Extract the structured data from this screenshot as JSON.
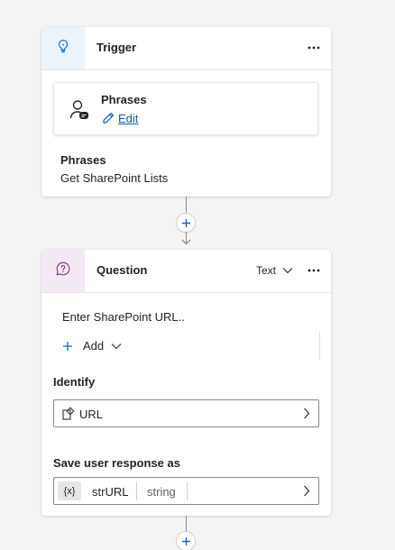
{
  "trigger": {
    "title": "Trigger",
    "phrases_card": {
      "title": "Phrases",
      "edit_label": "Edit"
    },
    "phrases_label": "Phrases",
    "phrases_value": "Get SharePoint Lists",
    "icon": "lightbulb-icon",
    "accent_color": "#0f6cbd",
    "header_icon_bg": "#ebf3fc"
  },
  "question": {
    "title": "Question",
    "type_label": "Text",
    "prompt": "Enter SharePoint URL..",
    "add_label": "Add",
    "identify_label": "Identify",
    "identify_value": "URL",
    "save_label": "Save user response as",
    "variable_badge": "{x}",
    "variable_name": "strURL",
    "variable_type": "string",
    "icon": "chat-question-icon",
    "accent_color": "#8a3a8a",
    "header_icon_bg": "#f3e9f3"
  }
}
